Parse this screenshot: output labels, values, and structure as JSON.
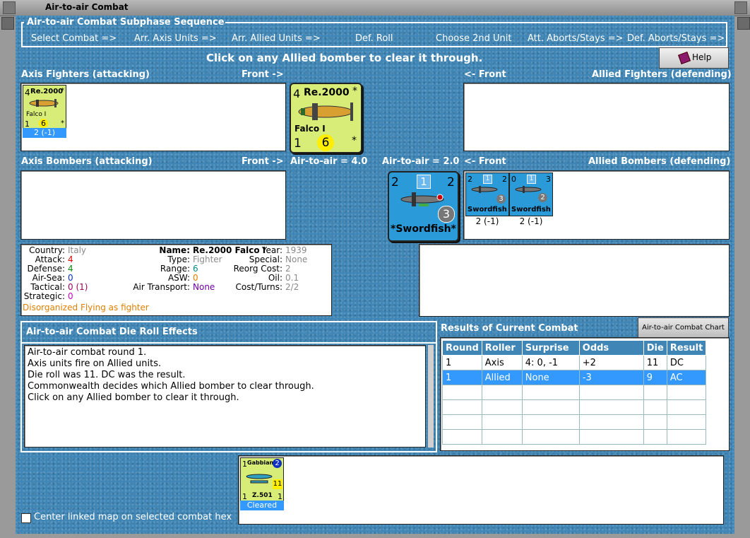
{
  "window": {
    "title": "Air-to-air Combat"
  },
  "sequence": {
    "legend": "Air-to-air Combat Subphase Sequence",
    "steps": [
      "Select Combat =>",
      "Arr. Axis Units =>",
      "Arr. Allied Units =>",
      "Def. Roll",
      "Choose 2nd Unit",
      "Att. Aborts/Stays =>",
      "Def. Aborts/Stays =>"
    ]
  },
  "instruction": "Click on any Allied bomber to clear it through.",
  "help_label": "Help",
  "sections": {
    "axis_fighters": "Axis Fighters (attacking)",
    "front_right": "Front ->",
    "front_left": "<- Front",
    "allied_fighters": "Allied Fighters (defending)",
    "axis_bombers": "Axis Bombers (attacking)",
    "allied_bombers": "Allied Bombers (defending)",
    "axis_air_to_air": "Air-to-air = 4.0",
    "allied_air_to_air": "Air-to-air = 2.0"
  },
  "axis_fighter_small": {
    "attack": "4",
    "name": "Re.2000",
    "star": "*",
    "subname": "Falco I",
    "tactical": "1",
    "range": "6",
    "star2": "*",
    "strength": "2 (-1)"
  },
  "axis_fighter_big": {
    "attack": "4",
    "name": "Re.2000",
    "star": "*",
    "subname": "Falco I",
    "tactical": "1",
    "range": "6",
    "star2": "*"
  },
  "allied_bomber_big": {
    "attack": "2",
    "airsea": "1",
    "defense": "2",
    "range": "3",
    "name": "*Swordfish*"
  },
  "allied_bomber_small_1": {
    "attack": "2",
    "airsea": "1",
    "defense": "2",
    "range": "3",
    "name": "Swordfish",
    "strength": "2 (-1)"
  },
  "allied_bomber_small_2": {
    "attack": "0",
    "airsea": "1",
    "defense": "3",
    "range": "2",
    "name": "Swordfish",
    "strength": "2 (-1)"
  },
  "unit_info": {
    "country_label": "Country:",
    "country": "Italy",
    "attack_label": "Attack:",
    "attack": "4",
    "defense_label": "Defense:",
    "defense": "4",
    "airsea_label": "Air-Sea:",
    "airsea": "0",
    "tactical_label": "Tactical:",
    "tactical": "0 (1)",
    "strategic_label": "Strategic:",
    "strategic": "0",
    "disorganized": "Disorganized",
    "flying": "Flying as fighter",
    "name_label": "Name:",
    "name": "Re.2000 Falco I",
    "type_label": "Type:",
    "type": "Fighter",
    "range_label": "Range:",
    "range": "6",
    "asw_label": "ASW:",
    "asw": "0",
    "air_transport_label": "Air Transport:",
    "air_transport": "None",
    "year_label": "Year:",
    "year": "1939",
    "special_label": "Special:",
    "special": "None",
    "reorg_label": "Reorg Cost:",
    "reorg": "2",
    "oil_label": "Oil:",
    "oil": "0.1",
    "cost_label": "Cost/Turns:",
    "cost": "2/2"
  },
  "die_effects": {
    "title": "Air-to-air Combat Die Roll Effects",
    "lines": [
      "Air-to-air combat round 1.",
      "Axis units fire on Allied units.",
      "Die roll was 11.  DC was the result.",
      "Commonwealth decides which Allied bomber to clear through.",
      "Click on any Allied bomber to clear it through."
    ]
  },
  "results": {
    "title": "Results of Current Combat",
    "chart_button": "Air-to-air Combat Chart",
    "headers": [
      "Round",
      "Roller",
      "Surprise",
      "Odds",
      "Die",
      "Result"
    ],
    "rows": [
      [
        "1",
        "Axis",
        "4: 0, -1",
        "+2",
        "11",
        "DC"
      ],
      [
        "1",
        "Allied",
        "None",
        "-3",
        "9",
        "AC"
      ]
    ]
  },
  "cleared_unit": {
    "attack": "1",
    "name": "Gabbiano",
    "airsea": "2",
    "range": "11",
    "defense": "1",
    "model": "Z.501",
    "tactical": "1",
    "status": "Cleared"
  },
  "center_checkbox_label": "Center linked map on selected combat hex",
  "colors": {
    "background": "#3f86b6",
    "fighter_counter": "#d8ec78",
    "bomber_counter": "#2a9ad8",
    "selected_strength": "#3399ff"
  }
}
